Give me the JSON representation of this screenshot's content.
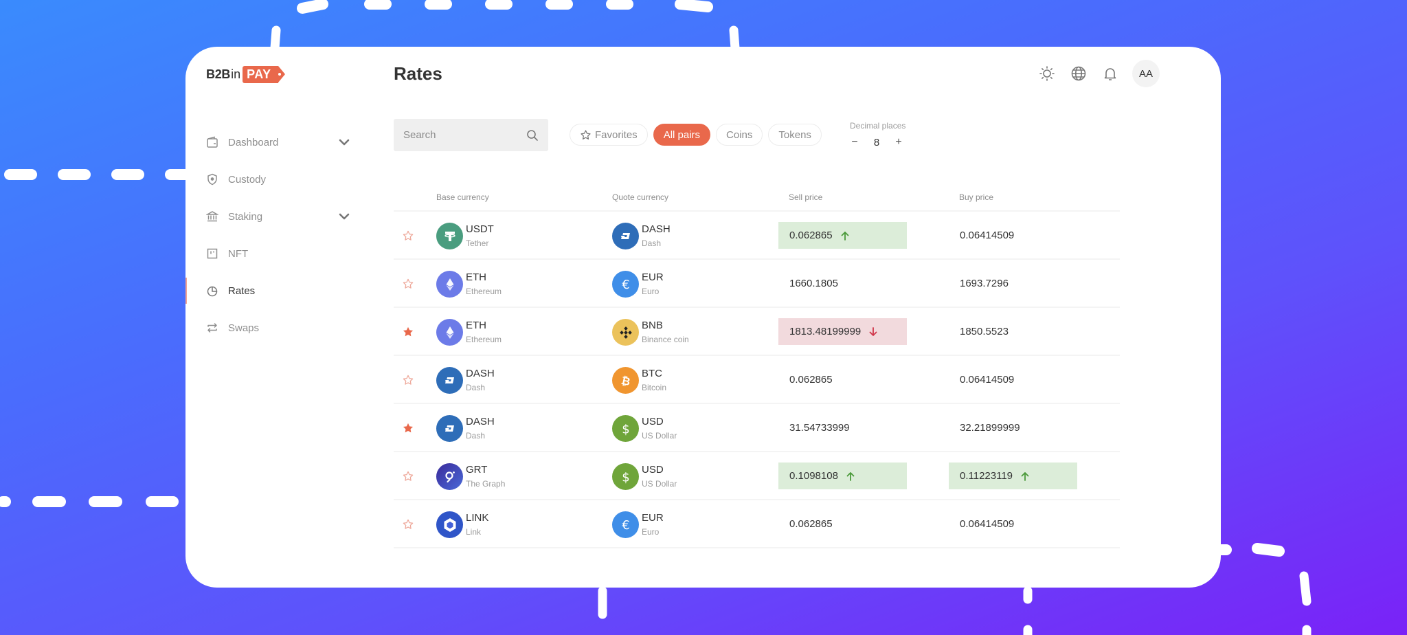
{
  "brand": {
    "part1": "B2B",
    "part2": "in",
    "part3": "PAY"
  },
  "header": {
    "title": "Rates",
    "icons": [
      "sun-icon",
      "globe-icon",
      "bell-icon"
    ],
    "avatar_initials": "AA"
  },
  "sidebar": {
    "items": [
      {
        "label": "Dashboard",
        "icon": "wallet-icon",
        "expandable": true,
        "active": false
      },
      {
        "label": "Custody",
        "icon": "shield-icon",
        "expandable": false,
        "active": false
      },
      {
        "label": "Staking",
        "icon": "bank-icon",
        "expandable": true,
        "active": false
      },
      {
        "label": "NFT",
        "icon": "nft-icon",
        "expandable": false,
        "active": false
      },
      {
        "label": "Rates",
        "icon": "pie-chart-icon",
        "expandable": false,
        "active": true
      },
      {
        "label": "Swaps",
        "icon": "swap-icon",
        "expandable": false,
        "active": false
      }
    ]
  },
  "toolbar": {
    "search_placeholder": "Search",
    "search_value": "",
    "filters": [
      {
        "label": "Favorites",
        "active": false,
        "icon": "star-outline-icon"
      },
      {
        "label": "All pairs",
        "active": true
      },
      {
        "label": "Coins",
        "active": false
      },
      {
        "label": "Tokens",
        "active": false
      }
    ],
    "decimals": {
      "label": "Decimal places",
      "value": "8",
      "minus": "−",
      "plus": "+"
    }
  },
  "table": {
    "columns": {
      "base": "Base currency",
      "quote": "Quote currency",
      "sell": "Sell price",
      "buy": "Buy price"
    },
    "rows": [
      {
        "favorite": false,
        "base": {
          "code": "USDT",
          "name": "Tether",
          "icon": "tether"
        },
        "quote": {
          "code": "DASH",
          "name": "Dash",
          "icon": "dash"
        },
        "sell": "0.062865",
        "sell_trend": "up",
        "buy": "0.06414509",
        "buy_trend": "none"
      },
      {
        "favorite": false,
        "base": {
          "code": "ETH",
          "name": "Ethereum",
          "icon": "eth"
        },
        "quote": {
          "code": "EUR",
          "name": "Euro",
          "icon": "eur"
        },
        "sell": "1660.1805",
        "sell_trend": "none",
        "buy": "1693.7296",
        "buy_trend": "none"
      },
      {
        "favorite": true,
        "base": {
          "code": "ETH",
          "name": "Ethereum",
          "icon": "eth"
        },
        "quote": {
          "code": "BNB",
          "name": "Binance coin",
          "icon": "bnb"
        },
        "sell": "1813.48199999",
        "sell_trend": "down",
        "buy": "1850.5523",
        "buy_trend": "none"
      },
      {
        "favorite": false,
        "base": {
          "code": "DASH",
          "name": "Dash",
          "icon": "dash"
        },
        "quote": {
          "code": "BTC",
          "name": "Bitcoin",
          "icon": "btc"
        },
        "sell": "0.062865",
        "sell_trend": "none",
        "buy": "0.06414509",
        "buy_trend": "none"
      },
      {
        "favorite": true,
        "base": {
          "code": "DASH",
          "name": "Dash",
          "icon": "dash"
        },
        "quote": {
          "code": "USD",
          "name": "US Dollar",
          "icon": "usd"
        },
        "sell": "31.54733999",
        "sell_trend": "none",
        "buy": "32.21899999",
        "buy_trend": "none"
      },
      {
        "favorite": false,
        "base": {
          "code": "GRT",
          "name": "The Graph",
          "icon": "grt"
        },
        "quote": {
          "code": "USD",
          "name": "US Dollar",
          "icon": "usd"
        },
        "sell": "0.1098108",
        "sell_trend": "up",
        "buy": "0.11223119",
        "buy_trend": "up"
      },
      {
        "favorite": false,
        "base": {
          "code": "LINK",
          "name": "Link",
          "icon": "link"
        },
        "quote": {
          "code": "EUR",
          "name": "Euro",
          "icon": "eur"
        },
        "sell": "0.062865",
        "sell_trend": "none",
        "buy": "0.06414509",
        "buy_trend": "none"
      }
    ]
  },
  "colors": {
    "accent": "#e9684b",
    "up_bg": "#dcedd9",
    "up_arrow": "#4a9a3a",
    "down_bg": "#f2dadd",
    "down_arrow": "#d0364a",
    "coin_tether": "#4a9d7f",
    "coin_dash": "#2e6db8",
    "coin_eth": "#6c7be8",
    "coin_eur": "#3f8ee8",
    "coin_bnb": "#ebc25b",
    "coin_btc": "#f0952f",
    "coin_usd": "#6fa53a",
    "coin_grt": "#3a3da8",
    "coin_link": "#2f55c8"
  }
}
